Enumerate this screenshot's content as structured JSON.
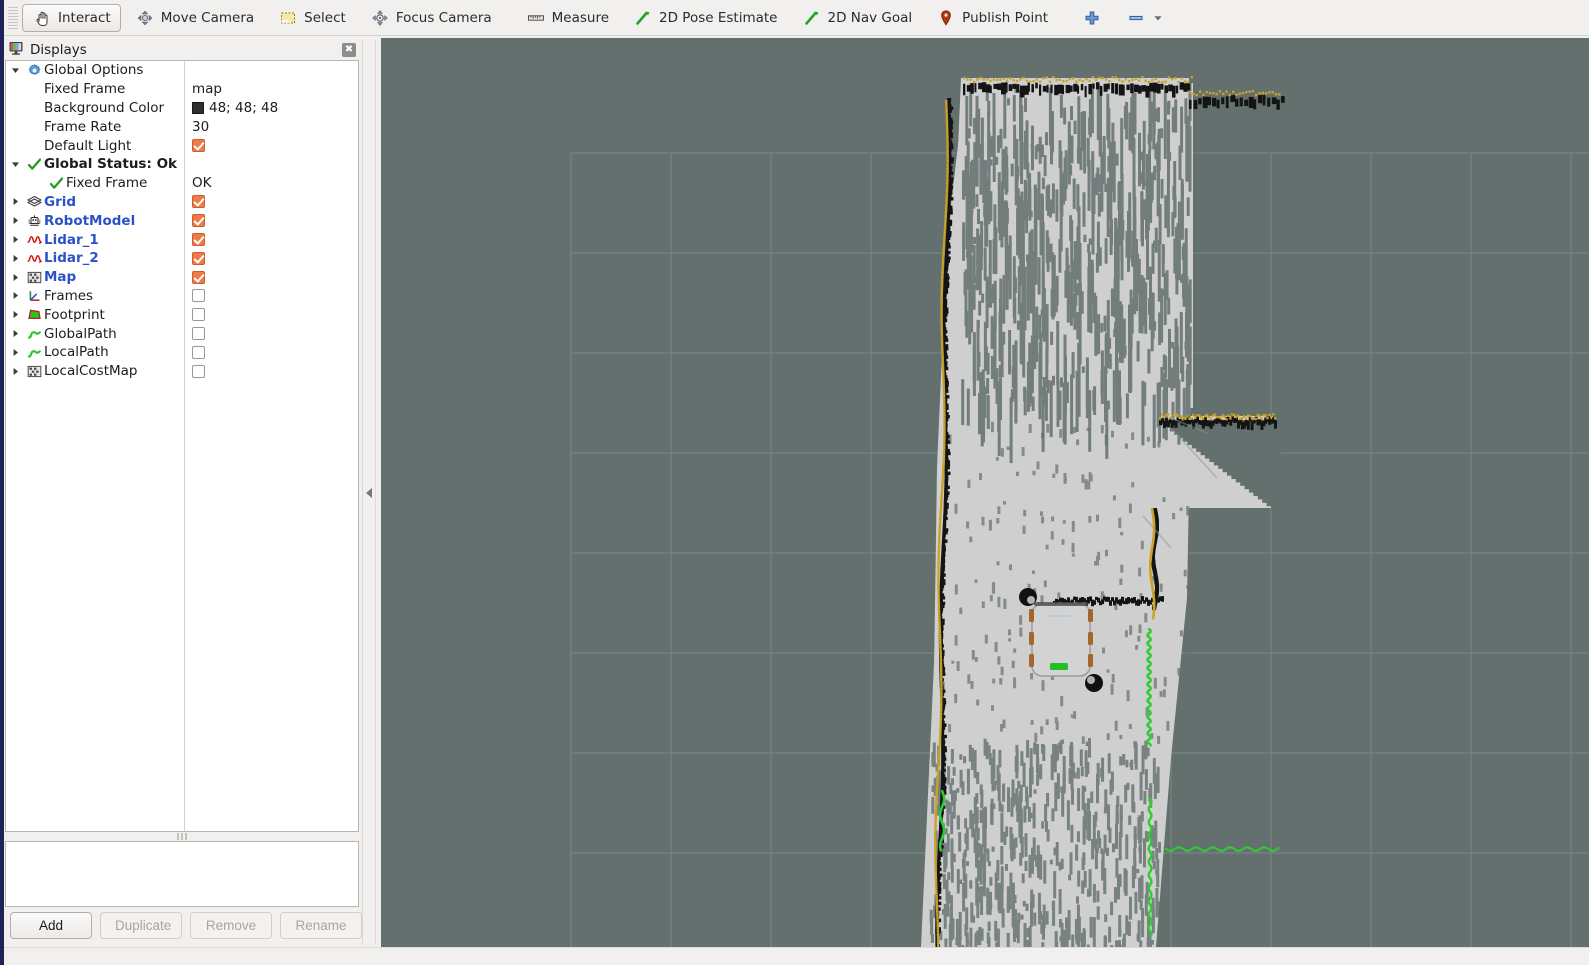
{
  "toolbar": {
    "items": [
      {
        "label": "Interact",
        "icon": "hand-cursor-icon",
        "active": true
      },
      {
        "label": "Move Camera",
        "icon": "move-camera-icon",
        "active": false
      },
      {
        "label": "Select",
        "icon": "select-rect-icon",
        "active": false
      },
      {
        "label": "Focus Camera",
        "icon": "focus-camera-icon",
        "active": false
      },
      {
        "label": "Measure",
        "icon": "ruler-icon",
        "active": false
      },
      {
        "label": "2D Pose Estimate",
        "icon": "pose-arrow-icon",
        "active": false
      },
      {
        "label": "2D Nav Goal",
        "icon": "nav-goal-arrow-icon",
        "active": false
      },
      {
        "label": "Publish Point",
        "icon": "map-pin-icon",
        "active": false
      }
    ],
    "add_tool_icon": "plus-icon",
    "remove_tool_icon": "minus-icon",
    "overflow_icon": "chevron-down-icon"
  },
  "displays": {
    "title": "Displays",
    "close_icon": "close-icon",
    "panel_icon": "displays-monitor-icon",
    "tree": [
      {
        "name": "Global Options",
        "icon": "gear-icon",
        "arrow": "expanded",
        "indent": 0,
        "style": "plain",
        "value_type": "none"
      },
      {
        "name": "Fixed Frame",
        "icon": "none",
        "arrow": "none",
        "indent": 1,
        "style": "plain",
        "value_type": "text",
        "value": "map"
      },
      {
        "name": "Background Color",
        "icon": "none",
        "arrow": "none",
        "indent": 1,
        "style": "plain",
        "value_type": "color",
        "value": "48; 48; 48",
        "color_hex": "#303030"
      },
      {
        "name": "Frame Rate",
        "icon": "none",
        "arrow": "none",
        "indent": 1,
        "style": "plain",
        "value_type": "text",
        "value": "30"
      },
      {
        "name": "Default Light",
        "icon": "none",
        "arrow": "none",
        "indent": 1,
        "style": "plain",
        "value_type": "checkbox",
        "checked": true
      },
      {
        "name": "Global Status: Ok",
        "icon": "check-icon",
        "arrow": "expanded",
        "indent": 0,
        "style": "status",
        "value_type": "none"
      },
      {
        "name": "Fixed Frame",
        "icon": "check-icon",
        "arrow": "none",
        "indent": 2,
        "style": "plain",
        "value_type": "text",
        "value": "OK"
      },
      {
        "name": "Grid",
        "icon": "grid-icon",
        "arrow": "collapsed",
        "indent": 0,
        "style": "enabled",
        "value_type": "checkbox",
        "checked": true
      },
      {
        "name": "RobotModel",
        "icon": "robot-icon",
        "arrow": "collapsed",
        "indent": 0,
        "style": "enabled",
        "value_type": "checkbox",
        "checked": true
      },
      {
        "name": "Lidar_1",
        "icon": "laserscan-icon",
        "arrow": "collapsed",
        "indent": 0,
        "style": "enabled",
        "value_type": "checkbox",
        "checked": true
      },
      {
        "name": "Lidar_2",
        "icon": "laserscan-icon",
        "arrow": "collapsed",
        "indent": 0,
        "style": "enabled",
        "value_type": "checkbox",
        "checked": true
      },
      {
        "name": "Map",
        "icon": "map-grid-icon",
        "arrow": "collapsed",
        "indent": 0,
        "style": "enabled",
        "value_type": "checkbox",
        "checked": true
      },
      {
        "name": "Frames",
        "icon": "axes-icon",
        "arrow": "collapsed",
        "indent": 0,
        "style": "plain",
        "value_type": "checkbox",
        "checked": false
      },
      {
        "name": "Footprint",
        "icon": "polygon-icon",
        "arrow": "collapsed",
        "indent": 0,
        "style": "plain",
        "value_type": "checkbox",
        "checked": false
      },
      {
        "name": "GlobalPath",
        "icon": "path-icon",
        "arrow": "collapsed",
        "indent": 0,
        "style": "plain",
        "value_type": "checkbox",
        "checked": false
      },
      {
        "name": "LocalPath",
        "icon": "path-icon",
        "arrow": "collapsed",
        "indent": 0,
        "style": "plain",
        "value_type": "checkbox",
        "checked": false
      },
      {
        "name": "LocalCostMap",
        "icon": "map-grid-icon",
        "arrow": "collapsed",
        "indent": 0,
        "style": "plain",
        "value_type": "checkbox",
        "checked": false
      }
    ],
    "buttons": [
      {
        "label": "Add",
        "enabled": true
      },
      {
        "label": "Duplicate",
        "enabled": false
      },
      {
        "label": "Remove",
        "enabled": false
      },
      {
        "label": "Rename",
        "enabled": false
      }
    ]
  },
  "viewport": {
    "background_color": "#63706e",
    "grid_line_color": "#8e9c99",
    "grid_spacing_px": 100,
    "map_free_color": "#cfcfcf",
    "map_occupied_color": "#141414",
    "lidar_1_color": "#c9a227",
    "lidar_2_color": "#2fcc34",
    "robot_body_color": "#d3d3d3",
    "robot_lidar_color": "#111111",
    "robot_post_color": "#a4662c",
    "robot_marker_color": "#22c022"
  }
}
